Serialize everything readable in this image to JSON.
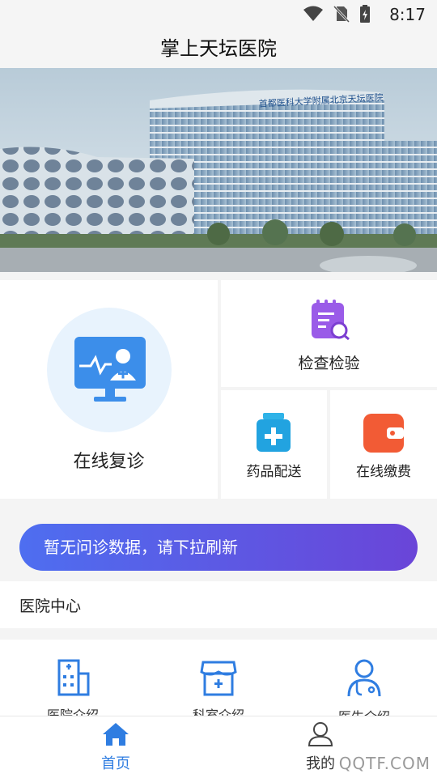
{
  "status_bar": {
    "time": "8:17"
  },
  "header": {
    "title": "掌上天坛医院"
  },
  "banner": {
    "building_sign": "首都医科大学附属北京天坛医院"
  },
  "services": {
    "main": {
      "label": "在线复诊",
      "icon": "doctor-monitor-icon"
    },
    "items": [
      {
        "label": "检查检验",
        "icon": "report-search-icon"
      },
      {
        "label": "药品配送",
        "icon": "medicine-bottle-icon"
      },
      {
        "label": "在线缴费",
        "icon": "wallet-icon"
      }
    ]
  },
  "notice": {
    "text": "暂无问诊数据，请下拉刷新"
  },
  "hospital_center": {
    "title": "医院中心",
    "items": [
      {
        "label": "医院介绍",
        "icon": "hospital-building-icon"
      },
      {
        "label": "科室介绍",
        "icon": "department-store-icon"
      },
      {
        "label": "医生介绍",
        "icon": "doctor-icon"
      }
    ]
  },
  "bottom_nav": {
    "items": [
      {
        "label": "首页",
        "icon": "home-icon",
        "active": true
      },
      {
        "label": "我的",
        "icon": "user-icon",
        "active": false
      }
    ]
  },
  "watermark": {
    "text": "QQTF.COM"
  },
  "colors": {
    "accent": "#2f7de1",
    "notice_start": "#4e6ef0",
    "notice_end": "#6a45d8"
  }
}
